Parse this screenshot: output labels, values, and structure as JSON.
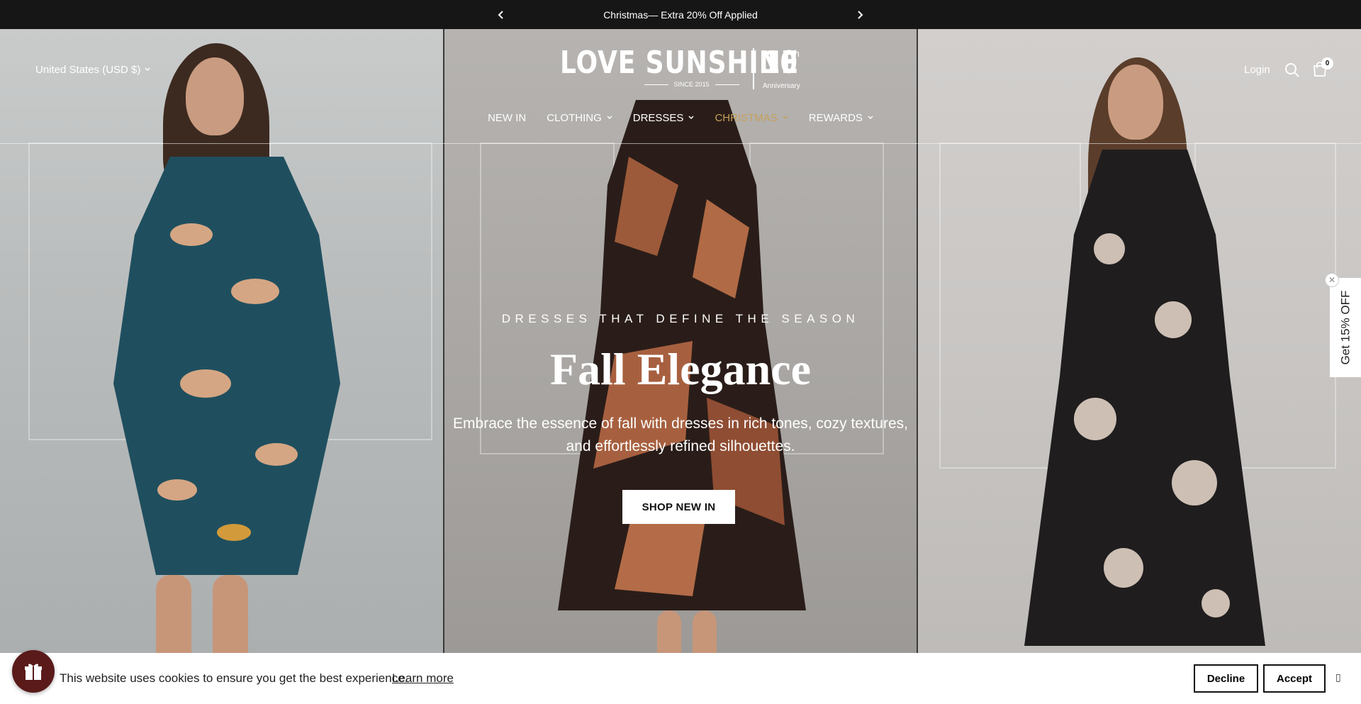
{
  "announcement": {
    "text": "Christmas— Extra 20% Off Applied",
    "prev_icon": "chevron-left-icon",
    "next_icon": "chevron-right-icon"
  },
  "header": {
    "country": "United States (USD $)",
    "logo": {
      "brand": "LOVE SUNSHINE",
      "since": "SINCE 2015",
      "ten": "10",
      "th": "th",
      "anniversary": "Anniversary"
    },
    "nav": [
      {
        "label": "NEW IN",
        "dropdown": false
      },
      {
        "label": "CLOTHING",
        "dropdown": true
      },
      {
        "label": "DRESSES",
        "dropdown": true
      },
      {
        "label": "CHRISTMAS",
        "dropdown": true
      },
      {
        "label": "REWARDS",
        "dropdown": true
      }
    ],
    "login": "Login",
    "cart_count": "0",
    "colors": {
      "christmas": "#c6a15b"
    }
  },
  "hero": {
    "eyebrow": "DRESSES THAT DEFINE THE SEASON",
    "title": "Fall Elegance",
    "description": "Embrace the essence of fall with dresses in rich tones, cozy textures, and effortlessly refined silhouettes.",
    "cta": "SHOP NEW IN"
  },
  "side_tab": {
    "label": "Get 15% OFF"
  },
  "cookie": {
    "text": "This website uses cookies to ensure you get the best experience.",
    "link": "Learn more",
    "decline": "Decline",
    "accept": "Accept"
  }
}
